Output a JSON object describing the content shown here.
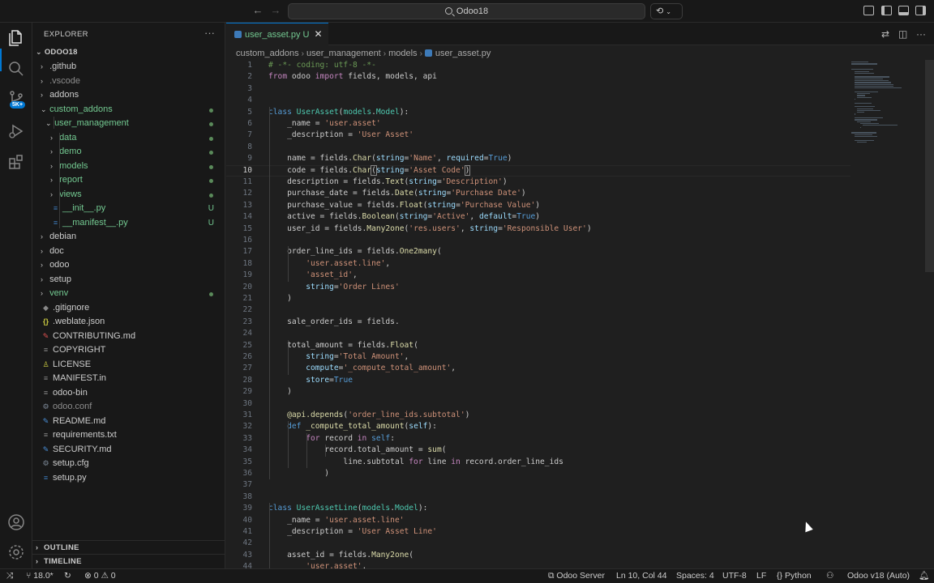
{
  "window": {
    "title": "Odoo18",
    "copilot_label": "⟲"
  },
  "activity_bar": {
    "source_control_badge": "5K+"
  },
  "sidebar": {
    "title": "EXPLORER",
    "root": "ODOO18",
    "tree": [
      {
        "label": ".github",
        "kind": "folder",
        "depth": 1
      },
      {
        "label": ".vscode",
        "kind": "folder",
        "depth": 1,
        "dim": true
      },
      {
        "label": "addons",
        "kind": "folder",
        "depth": 1
      },
      {
        "label": "custom_addons",
        "kind": "folder-open",
        "depth": 1,
        "green": true,
        "dot": true
      },
      {
        "label": "user_management",
        "kind": "folder-open",
        "depth": 2,
        "green": true,
        "dot": true
      },
      {
        "label": "data",
        "kind": "folder",
        "depth": 3,
        "green": true,
        "dot": true
      },
      {
        "label": "demo",
        "kind": "folder",
        "depth": 3,
        "green": true,
        "dot": true
      },
      {
        "label": "models",
        "kind": "folder",
        "depth": 3,
        "green": true,
        "dot": true
      },
      {
        "label": "report",
        "kind": "folder",
        "depth": 3,
        "green": true,
        "dot": true
      },
      {
        "label": "views",
        "kind": "folder",
        "depth": 3,
        "green": true,
        "dot": true
      },
      {
        "label": "__init__.py",
        "kind": "py",
        "depth": 3,
        "green": true,
        "u": "U"
      },
      {
        "label": "__manifest__.py",
        "kind": "py",
        "depth": 3,
        "green": true,
        "u": "U"
      },
      {
        "label": "debian",
        "kind": "folder",
        "depth": 1
      },
      {
        "label": "doc",
        "kind": "folder",
        "depth": 1
      },
      {
        "label": "odoo",
        "kind": "folder",
        "depth": 1
      },
      {
        "label": "setup",
        "kind": "folder",
        "depth": 1
      },
      {
        "label": "venv",
        "kind": "folder",
        "depth": 1,
        "green": true,
        "dot": true
      },
      {
        "label": ".gitignore",
        "kind": "git",
        "depth": 1
      },
      {
        "label": ".weblate.json",
        "kind": "json",
        "depth": 1
      },
      {
        "label": "CONTRIBUTING.md",
        "kind": "md-red",
        "depth": 1
      },
      {
        "label": "COPYRIGHT",
        "kind": "txt",
        "depth": 1
      },
      {
        "label": "LICENSE",
        "kind": "lic",
        "depth": 1
      },
      {
        "label": "MANIFEST.in",
        "kind": "txt",
        "depth": 1
      },
      {
        "label": "odoo-bin",
        "kind": "txt",
        "depth": 1
      },
      {
        "label": "odoo.conf",
        "kind": "gear",
        "depth": 1,
        "dim": true
      },
      {
        "label": "README.md",
        "kind": "md",
        "depth": 1
      },
      {
        "label": "requirements.txt",
        "kind": "txt",
        "depth": 1
      },
      {
        "label": "SECURITY.md",
        "kind": "md",
        "depth": 1
      },
      {
        "label": "setup.cfg",
        "kind": "gear",
        "depth": 1
      },
      {
        "label": "setup.py",
        "kind": "py",
        "depth": 1
      }
    ],
    "outline": "OUTLINE",
    "timeline": "TIMELINE"
  },
  "tab": {
    "filename": "user_asset.py",
    "status": "U"
  },
  "breadcrumb": [
    "custom_addons",
    "user_management",
    "models",
    "user_asset.py"
  ],
  "editor": {
    "current_line": 10,
    "lines": [
      "<span class='c'># -*- coding: utf-8 -*-</span>",
      "<span class='kc'>from</span> odoo <span class='kc'>import</span> fields, models, api",
      "",
      "",
      "<span class='k'>class</span> <span class='t'>UserAsset</span>(<span class='t'>models</span>.<span class='t'>Model</span>):",
      "    _name = <span class='s'>'user.asset'</span>",
      "    _description = <span class='s'>'User Asset'</span>",
      "",
      "    name = fields.<span class='f'>Char</span>(<span class='p'>string</span>=<span class='s'>'Name'</span>, <span class='p'>required</span>=<span class='k'>True</span>)",
      "    code = fields.<span class='f'>Char</span><span class='bx'>(</span><span class='p'>string</span>=<span class='s'>'Asset Code'</span><span class='bx'>)</span>",
      "    description = fields.<span class='f'>Text</span>(<span class='p'>string</span>=<span class='s'>'Description'</span>)",
      "    purchase_date = fields.<span class='f'>Date</span>(<span class='p'>string</span>=<span class='s'>'Purchase Date'</span>)",
      "    purchase_value = fields.<span class='f'>Float</span>(<span class='p'>string</span>=<span class='s'>'Purchase Value'</span>)",
      "    active = fields.<span class='f'>Boolean</span>(<span class='p'>string</span>=<span class='s'>'Active'</span>, <span class='p'>default</span>=<span class='k'>True</span>)",
      "    user_id = fields.<span class='f'>Many2one</span>(<span class='s'>'res.users'</span>, <span class='p'>string</span>=<span class='s'>'Responsible User'</span>)",
      "",
      "    order_line_ids = fields.<span class='f'>One2many</span>(",
      "        <span class='s'>'user.asset.line'</span>,",
      "        <span class='s'>'asset_id'</span>,",
      "        <span class='p'>string</span>=<span class='s'>'Order Lines'</span>",
      "    )",
      "",
      "    sale_order_ids = fields.",
      "",
      "    total_amount = fields.<span class='f'>Float</span>(",
      "        <span class='p'>string</span>=<span class='s'>'Total Amount'</span>,",
      "        <span class='p'>compute</span>=<span class='s'>'_compute_total_amount'</span>,",
      "        <span class='p'>store</span>=<span class='k'>True</span>",
      "    )",
      "",
      "    <span class='f'>@api.depends</span>(<span class='s'>'order_line_ids.subtotal'</span>)",
      "    <span class='k'>def</span> <span class='f'>_compute_total_amount</span>(<span class='p'>self</span>):",
      "        <span class='kc'>for</span> record <span class='kc'>in</span> <span class='k'>self</span>:",
      "            record.total_amount = <span class='f'>sum</span>(",
      "                line.subtotal <span class='kc'>for</span> line <span class='kc'>in</span> record.order_line_ids",
      "            )",
      "",
      "",
      "<span class='k'>class</span> <span class='t'>UserAssetLine</span>(<span class='t'>models</span>.<span class='t'>Model</span>):",
      "    _name = <span class='s'>'user.asset.line'</span>",
      "    _description = <span class='s'>'User Asset Line'</span>",
      "",
      "    asset_id = fields.<span class='f'>Many2one</span>(",
      "        <span class='s'>'user.asset'</span>,"
    ]
  },
  "status_bar": {
    "python_version": "18.0*",
    "problems": "⊗ 0 ⚠ 0",
    "server": "Odoo Server",
    "position": "Ln 10, Col 44",
    "spaces": "Spaces: 4",
    "encoding": "UTF-8",
    "eol": "LF",
    "language": "Python",
    "interpreter": "Odoo v18 (Auto)"
  }
}
